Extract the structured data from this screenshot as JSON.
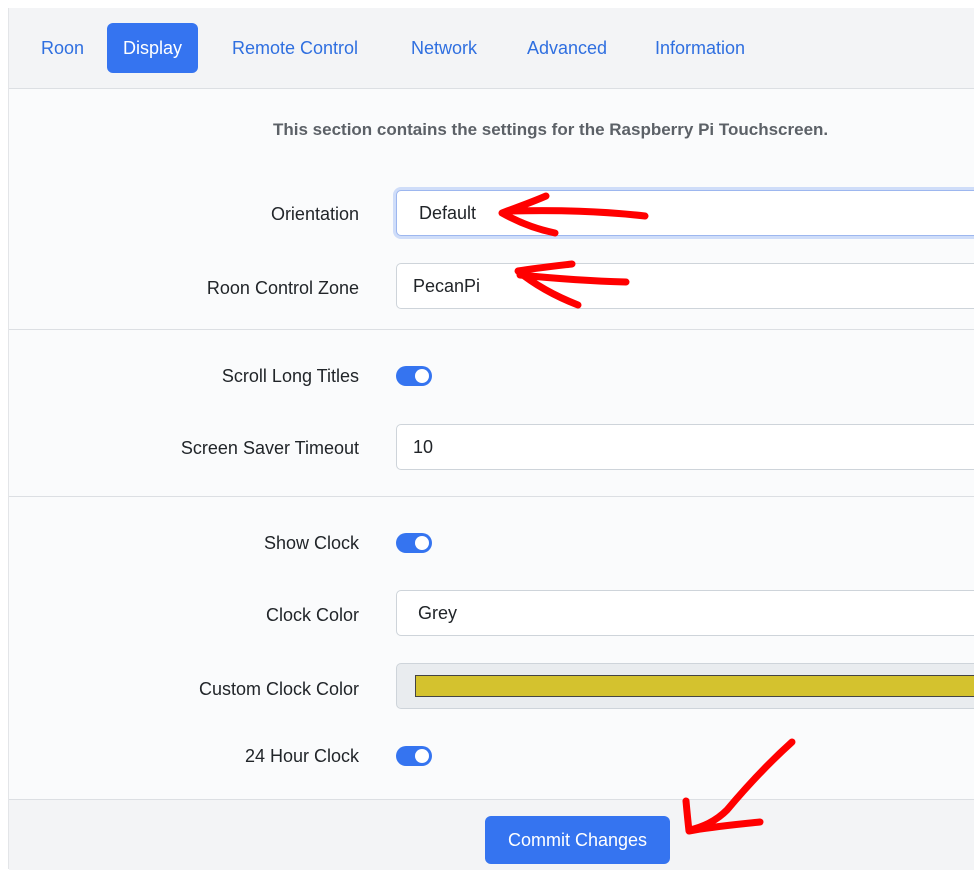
{
  "colors": {
    "accent": "#3574f0",
    "annotation": "#ff0000",
    "custom_clock_color": "#d4c22e"
  },
  "tabs": [
    {
      "label": "Roon",
      "active": false
    },
    {
      "label": "Display",
      "active": true
    },
    {
      "label": "Remote Control",
      "active": false
    },
    {
      "label": "Network",
      "active": false
    },
    {
      "label": "Advanced",
      "active": false
    },
    {
      "label": "Information",
      "active": false
    }
  ],
  "intro": "This section contains the settings for the Raspberry Pi Touchscreen.",
  "fields": {
    "orientation": {
      "label": "Orientation",
      "value": "Default"
    },
    "zone": {
      "label": "Roon Control Zone",
      "value": "PecanPi"
    },
    "scroll_titles": {
      "label": "Scroll Long Titles",
      "checked": true
    },
    "screensaver": {
      "label": "Screen Saver Timeout",
      "value": "10"
    },
    "show_clock": {
      "label": "Show Clock",
      "checked": true
    },
    "clock_color": {
      "label": "Clock Color",
      "value": "Grey"
    },
    "custom_clock_color": {
      "label": "Custom Clock Color"
    },
    "hour24": {
      "label": "24 Hour Clock",
      "checked": true
    }
  },
  "footer": {
    "commit_label": "Commit Changes"
  }
}
